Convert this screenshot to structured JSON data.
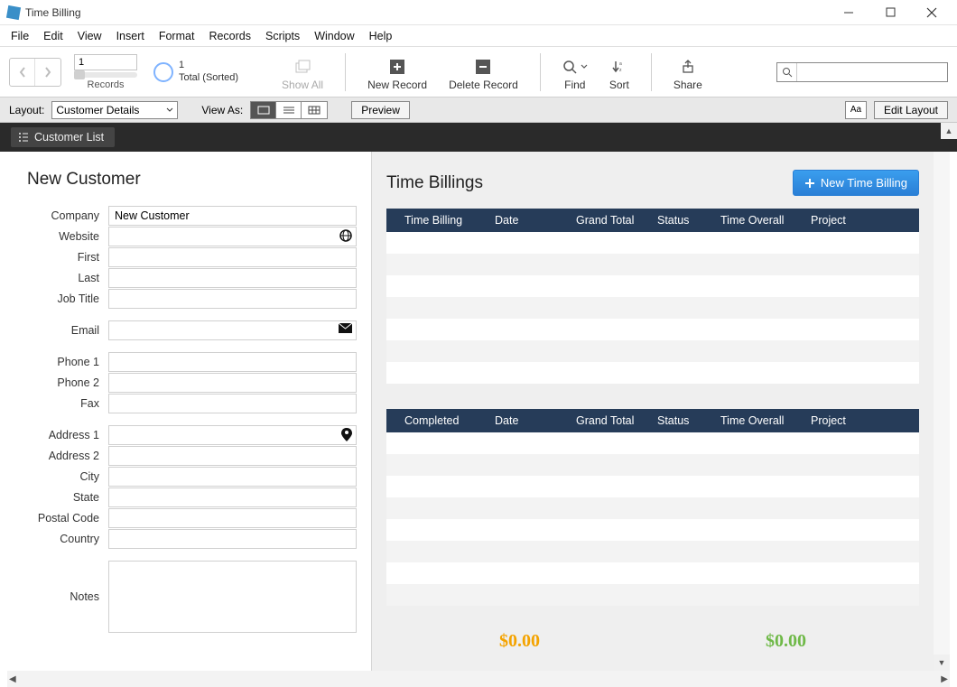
{
  "window": {
    "title": "Time Billing"
  },
  "menu": {
    "file": "File",
    "edit": "Edit",
    "view": "View",
    "insert": "Insert",
    "format": "Format",
    "records": "Records",
    "scripts": "Scripts",
    "window": "Window",
    "help": "Help"
  },
  "toolbar": {
    "record_number": "1",
    "records_label": "Records",
    "found_count": "1",
    "found_label": "Total (Sorted)",
    "show_all": "Show All",
    "new_record": "New Record",
    "delete_record": "Delete Record",
    "find": "Find",
    "sort": "Sort",
    "share": "Share",
    "search_value": ""
  },
  "layoutbar": {
    "layout_label": "Layout:",
    "layout_name": "Customer Details",
    "view_as": "View As:",
    "preview": "Preview",
    "aa": "Aa",
    "edit_layout": "Edit Layout"
  },
  "darkbar": {
    "customer_list": "Customer List"
  },
  "form": {
    "heading": "New Customer",
    "labels": {
      "company": "Company",
      "website": "Website",
      "first": "First",
      "last": "Last",
      "job_title": "Job Title",
      "email": "Email",
      "phone1": "Phone 1",
      "phone2": "Phone 2",
      "fax": "Fax",
      "address1": "Address 1",
      "address2": "Address 2",
      "city": "City",
      "state": "State",
      "postal": "Postal Code",
      "country": "Country",
      "notes": "Notes"
    },
    "values": {
      "company": "New Customer",
      "website": "",
      "first": "",
      "last": "",
      "job_title": "",
      "email": "",
      "phone1": "",
      "phone2": "",
      "fax": "",
      "address1": "",
      "address2": "",
      "city": "",
      "state": "",
      "postal": "",
      "country": "",
      "notes": ""
    }
  },
  "right": {
    "heading": "Time Billings",
    "new_billing": "New Time Billing",
    "table1": {
      "cols": [
        "Time Billing",
        "Date",
        "Grand Total",
        "Status",
        "Time Overall",
        "Project"
      ]
    },
    "table2": {
      "cols": [
        "Completed",
        "Date",
        "Grand Total",
        "Status",
        "Time Overall",
        "Project"
      ]
    },
    "total1": "$0.00",
    "total2": "$0.00"
  }
}
